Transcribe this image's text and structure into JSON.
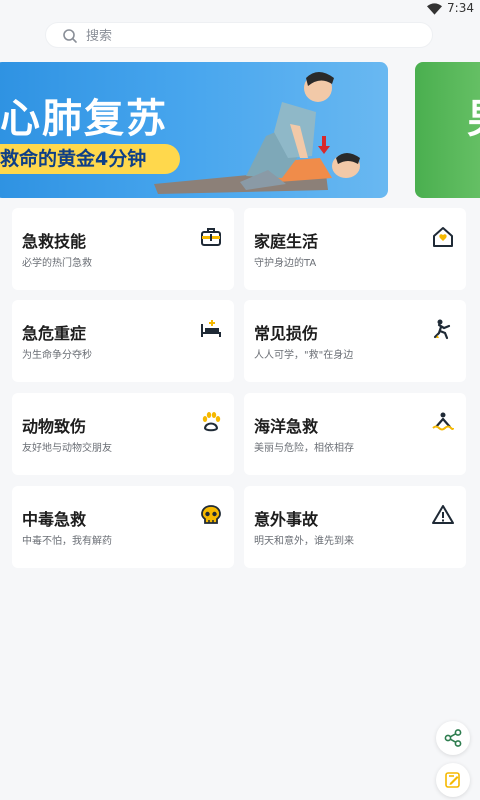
{
  "status_bar": {
    "time": "7:34"
  },
  "search": {
    "placeholder": "搜索"
  },
  "banners": [
    {
      "title": "心肺复苏",
      "subtitle": "救命的黄金4分钟"
    },
    {
      "title_fragment": "男"
    }
  ],
  "categories": [
    {
      "title": "急救技能",
      "desc": "必学的热门急救",
      "icon": "first-aid-kit-icon"
    },
    {
      "title": "家庭生活",
      "desc": "守护身边的TA",
      "icon": "house-icon"
    },
    {
      "title": "急危重症",
      "desc": "为生命争分夺秒",
      "icon": "hospital-bed-icon"
    },
    {
      "title": "常见损伤",
      "desc": "人人可学，\"救\"在身边",
      "icon": "injury-icon"
    },
    {
      "title": "动物致伤",
      "desc": "友好地与动物交朋友",
      "icon": "paw-icon"
    },
    {
      "title": "海洋急救",
      "desc": "美丽与危险，相依相存",
      "icon": "drowning-icon"
    },
    {
      "title": "中毒急救",
      "desc": "中毒不怕，我有解药",
      "icon": "skull-icon"
    },
    {
      "title": "意外事故",
      "desc": "明天和意外，谁先到来",
      "icon": "warning-icon"
    }
  ],
  "floating_buttons": [
    {
      "icon": "share-icon"
    },
    {
      "icon": "edit-icon"
    }
  ],
  "colors": {
    "accent": "#f5b800",
    "icon_dark": "#1f2a36",
    "banner_blue": "#3a9be8",
    "banner_yellow": "#ffd84c",
    "banner_green": "#4aaf4f"
  }
}
